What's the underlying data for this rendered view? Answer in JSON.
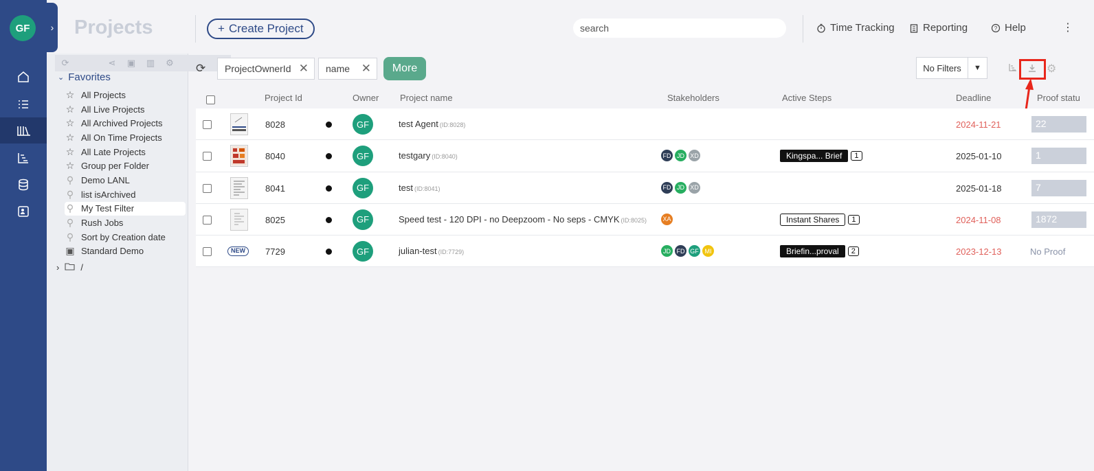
{
  "user": {
    "initials": "GF"
  },
  "header": {
    "title": "Projects",
    "create_label": "Create Project",
    "search_placeholder": "search",
    "time_tracking": "Time Tracking",
    "reporting": "Reporting",
    "help": "Help"
  },
  "sidebar": {
    "favorites_label": "Favorites",
    "items": [
      {
        "label": "All Projects",
        "icon": "star-icon"
      },
      {
        "label": "All Live Projects",
        "icon": "star-icon"
      },
      {
        "label": "All Archived Projects",
        "icon": "star-icon"
      },
      {
        "label": "All On Time Projects",
        "icon": "star-icon"
      },
      {
        "label": "All Late Projects",
        "icon": "star-icon"
      },
      {
        "label": "Group per Folder",
        "icon": "star-icon"
      },
      {
        "label": "Demo LANL",
        "icon": "search-filter-icon"
      },
      {
        "label": "list isArchived",
        "icon": "search-filter-icon"
      },
      {
        "label": "My Test Filter",
        "icon": "search-filter-icon",
        "selected": true
      },
      {
        "label": "Rush Jobs",
        "icon": "search-filter-icon"
      },
      {
        "label": "Sort by Creation date",
        "icon": "search-filter-icon"
      },
      {
        "label": "Standard Demo",
        "icon": "folder-heart-icon"
      }
    ],
    "root_label": "/"
  },
  "filters": {
    "chip1": "ProjectOwnerId",
    "chip2": "name",
    "more_label": "More",
    "no_filters": "No Filters"
  },
  "table": {
    "columns": {
      "project_id": "Project Id",
      "owner": "Owner",
      "project_name": "Project name",
      "stakeholders": "Stakeholders",
      "active_steps": "Active Steps",
      "deadline": "Deadline",
      "proof_status": "Proof statu"
    },
    "rows": [
      {
        "id": "8028",
        "owner": "GF",
        "name": "test Agent",
        "idtag": "(ID:8028)",
        "deadline": "2024-11-21",
        "proof": "22"
      },
      {
        "id": "8040",
        "owner": "GF",
        "name": "testgary",
        "idtag": "(ID:8040)",
        "step": "Kingspa... Brief",
        "step_count": "1",
        "deadline": "2025-01-10",
        "proof": "1"
      },
      {
        "id": "8041",
        "owner": "GF",
        "name": "test",
        "idtag": "(ID:8041)",
        "deadline": "2025-01-18",
        "proof": "7"
      },
      {
        "id": "8025",
        "owner": "GF",
        "name": "Speed test - 120 DPI - no Deepzoom - No seps - CMYK",
        "idtag": "(ID:8025)",
        "step": "Instant Shares",
        "step_count": "1",
        "deadline": "2024-11-08",
        "proof": "1872"
      },
      {
        "id": "7729",
        "owner": "GF",
        "name": "julian-test",
        "idtag": "(ID:7729)",
        "badge": "NEW",
        "step": "Briefin...proval",
        "step_count": "2",
        "deadline": "2023-12-13",
        "proof": "No Proof"
      }
    ],
    "stakeholders": {
      "fd": "FD",
      "jd": "JD",
      "xd": "XD",
      "xa": "XA",
      "gf": "GF",
      "mi": "MI"
    }
  },
  "colors": {
    "rail": "#2e4a87",
    "accent_green": "#1e9f7c",
    "more_green": "#5aa98c",
    "late_red": "#e0605a",
    "highlight_red": "#e8261b"
  }
}
